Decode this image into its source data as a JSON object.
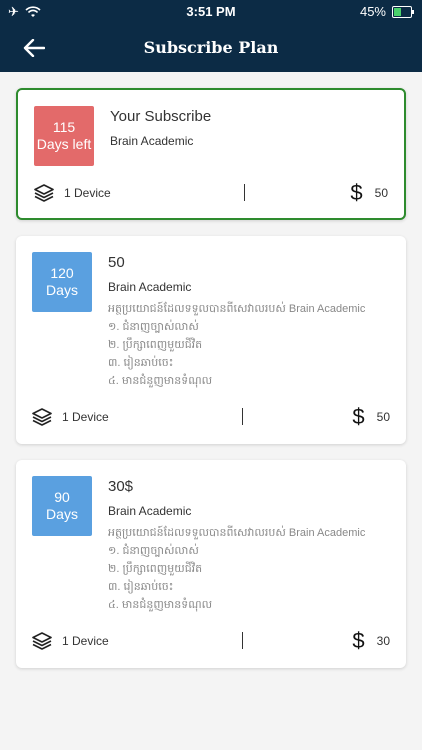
{
  "status_bar": {
    "time": "3:51 PM",
    "battery": "45%",
    "battery_level": 0.45
  },
  "header": {
    "title": "Subscribe Plan"
  },
  "current": {
    "days": "115",
    "days_label": "Days left",
    "title": "Your Subscribe",
    "subtitle": "Brain Academic",
    "devices": "1 Device",
    "price": "50"
  },
  "plans": [
    {
      "days": "120",
      "days_label": "Days",
      "title": "50",
      "subtitle": "Brain Academic",
      "features": [
        "អត្ថប្រយោជន៍ដែលទទួលបានពីសេវាលរបស់ Brain Academic",
        "១. ជំនាញច្បាស់លាស់",
        "២. ប្រឹក្សាពេញមួយជីវិត",
        "៣. រៀនឆាប់ចេះ",
        "៤. មានជំនួញមានទំណុល"
      ],
      "devices": "1 Device",
      "price": "50"
    },
    {
      "days": "90",
      "days_label": "Days",
      "title": "30$",
      "subtitle": "Brain Academic",
      "features": [
        "អត្ថប្រយោជន៍ដែលទទួលបានពីសេវាលរបស់ Brain Academic",
        "១. ជំនាញច្បាស់លាស់",
        "២. ប្រឹក្សាពេញមួយជីវិត",
        "៣. រៀនឆាប់ចេះ",
        "៤. មានជំនួញមានទំណុល"
      ],
      "devices": "1 Device",
      "price": "30"
    }
  ]
}
